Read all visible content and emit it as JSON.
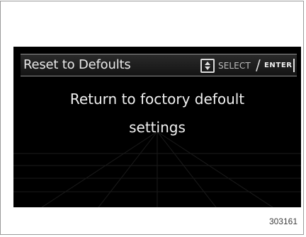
{
  "menu": {
    "title": "Reset to Defoults",
    "select_label": "SELECT",
    "separator": "/",
    "enter_label": "ENTER",
    "updown_icon": "up-down-arrow-icon"
  },
  "message": {
    "line1": "Return to foctory defoult",
    "line2": "settings"
  },
  "figure": {
    "number": "303161"
  },
  "colors": {
    "screen_background": "#000000",
    "text": "#f1f1f1",
    "header_border": "#8f8f8f"
  }
}
